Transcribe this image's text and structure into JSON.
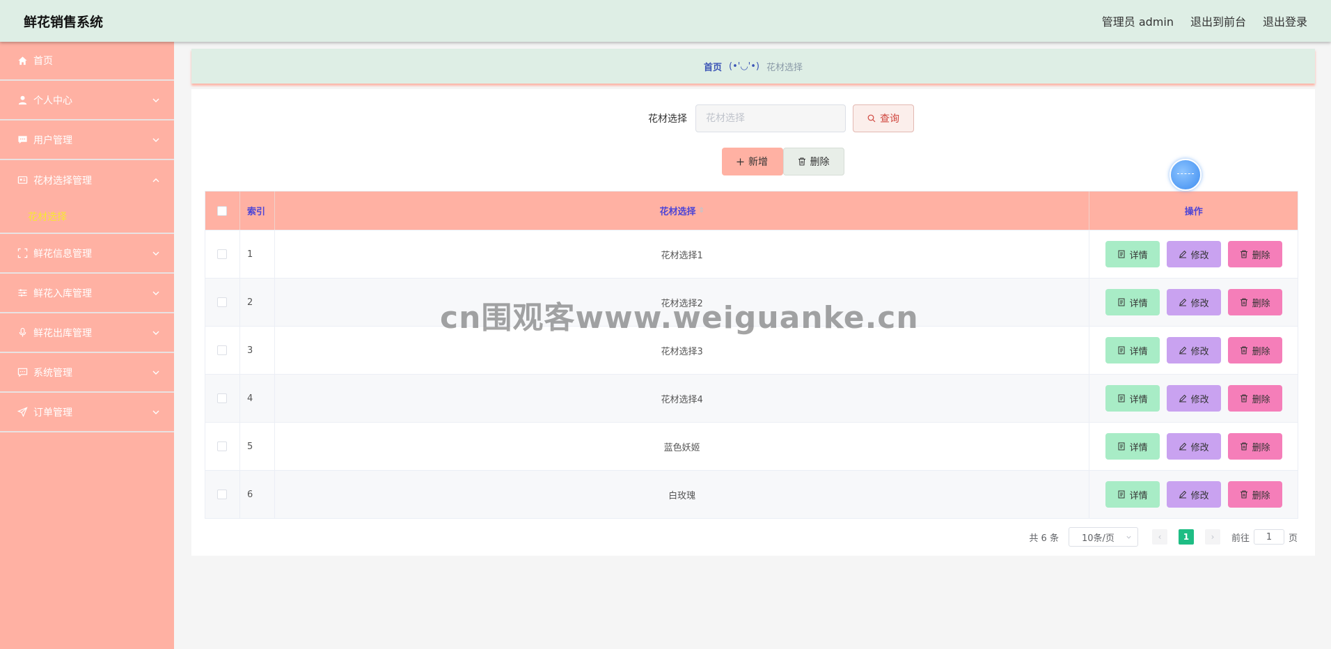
{
  "header": {
    "title": "鲜花销售系统",
    "user": "管理员 admin",
    "to_front": "退出到前台",
    "logout": "退出登录"
  },
  "sidebar": {
    "items": [
      {
        "label": "首页",
        "icon": "home-icon"
      },
      {
        "label": "个人中心",
        "icon": "user-icon"
      },
      {
        "label": "用户管理",
        "icon": "message-icon"
      },
      {
        "label": "花材选择管理",
        "icon": "card-icon"
      },
      {
        "label": "鲜花信息管理",
        "icon": "fullscreen-icon"
      },
      {
        "label": "鲜花入库管理",
        "icon": "sliders-icon"
      },
      {
        "label": "鲜花出库管理",
        "icon": "microphone-icon"
      },
      {
        "label": "系统管理",
        "icon": "chat-icon"
      },
      {
        "label": "订单管理",
        "icon": "send-icon"
      }
    ],
    "submenu": {
      "label": "花材选择"
    }
  },
  "breadcrumb": {
    "home": "首页",
    "face": "(•'◡'•)",
    "current": "花材选择"
  },
  "search": {
    "label": "花材选择",
    "placeholder": "花材选择",
    "button": "查询"
  },
  "actions": {
    "add": "新增",
    "delete": "删除"
  },
  "table": {
    "headers": {
      "index": "索引",
      "name": "花材选择",
      "ops": "操作"
    },
    "rows": [
      {
        "index": "1",
        "name": "花材选择1"
      },
      {
        "index": "2",
        "name": "花材选择2"
      },
      {
        "index": "3",
        "name": "花材选择3"
      },
      {
        "index": "4",
        "name": "花材选择4"
      },
      {
        "index": "5",
        "name": "蓝色妖姬"
      },
      {
        "index": "6",
        "name": "白玫瑰"
      }
    ],
    "ops": {
      "detail": "详情",
      "edit": "修改",
      "delete": "删除"
    }
  },
  "pagination": {
    "total": "共 6 条",
    "page_size": "10条/页",
    "current": "1",
    "goto": "前往",
    "goto_value": "1",
    "page_unit": "页"
  },
  "watermark": "cn围观客www.weiguanke.cn",
  "colors": {
    "header_bg": "#deeee5",
    "sidebar_bg": "#ffb1a3",
    "submenu_active": "#f7e733",
    "table_header": "#ffb1a3",
    "detail_btn": "#a8ecc6",
    "edit_btn": "#c9a2f0",
    "delete_btn": "#f57eb9",
    "page_active": "#1ebd84"
  }
}
